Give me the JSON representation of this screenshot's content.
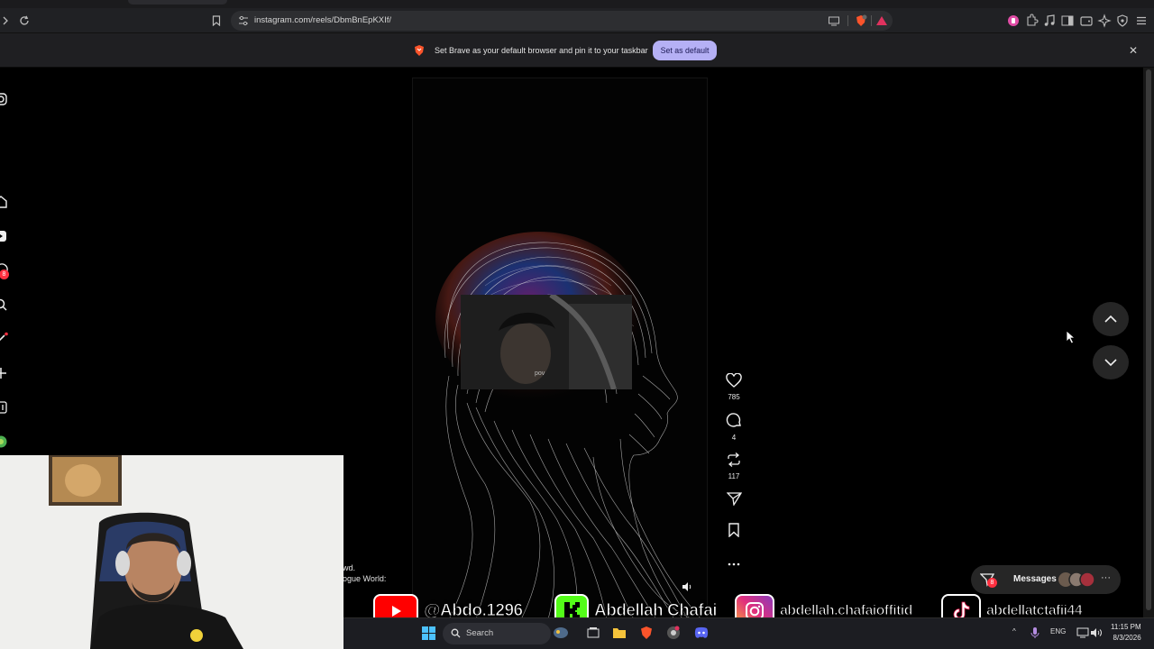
{
  "browser": {
    "url": "instagram.com/reels/DbmBnEpKXIf/",
    "infobar": {
      "message": "Set Brave as your default browser and pin it to your taskbar",
      "button": "Set as default"
    }
  },
  "reel": {
    "inset_tag": "pov",
    "actions": {
      "likes": "785",
      "comments": "4",
      "reposts": "117"
    },
    "caption_line1": "wd.",
    "caption_line2": "ogue World:"
  },
  "messages": {
    "label": "Messages",
    "badge": "8"
  },
  "sidebar": {
    "notifications_badge": "8"
  },
  "social_banner": {
    "youtube": "@Abdo.1296",
    "kick": "Abdellah Chafai",
    "instagram": "abdellah.chafaioffitid",
    "tiktok": "abdellatctafii44"
  },
  "taskbar": {
    "search": "Search",
    "language": "ENG",
    "time": "11:15 PM",
    "date": "8/3/2026"
  },
  "icons": {
    "sidebar": [
      "instagram-icon",
      "home-icon",
      "reels-icon",
      "messenger-icon",
      "search-icon",
      "explore-icon",
      "create-icon",
      "dashboard-icon",
      "profile-icon"
    ],
    "actions": [
      "heart-icon",
      "comment-icon",
      "repost-icon",
      "share-icon",
      "save-icon",
      "more-icon"
    ]
  },
  "colors": {
    "accent_button": "#b5b0f5",
    "badge": "#ff3040",
    "youtube": "#ff0000",
    "kick": "#53fc18",
    "tiktok": "#000000"
  }
}
